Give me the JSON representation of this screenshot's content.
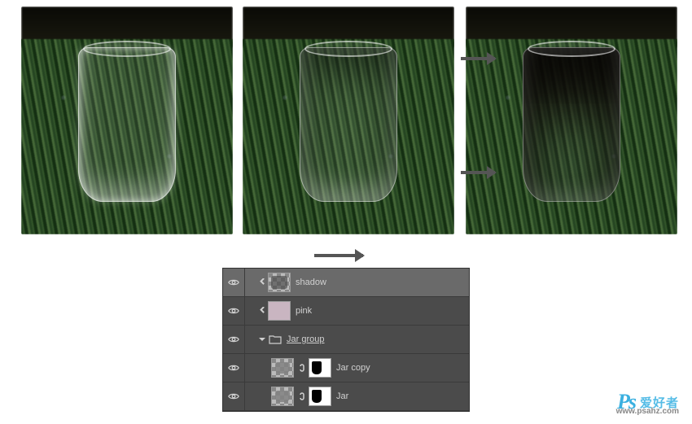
{
  "layers": [
    {
      "name": "shadow",
      "clip": true,
      "thumb": "checker-blob",
      "selected": true
    },
    {
      "name": "pink",
      "clip": true,
      "thumb": "pink",
      "selected": false
    },
    {
      "name": "Jar group",
      "group": true,
      "selected": false
    },
    {
      "name": "Jar copy",
      "indent": 2,
      "thumb": "jar-mask",
      "selected": false
    },
    {
      "name": "Jar",
      "indent": 2,
      "thumb": "jar-mask",
      "selected": false
    }
  ],
  "watermark": {
    "logo": "Ps",
    "text": "爱好者",
    "url": "www.psahz.com"
  }
}
